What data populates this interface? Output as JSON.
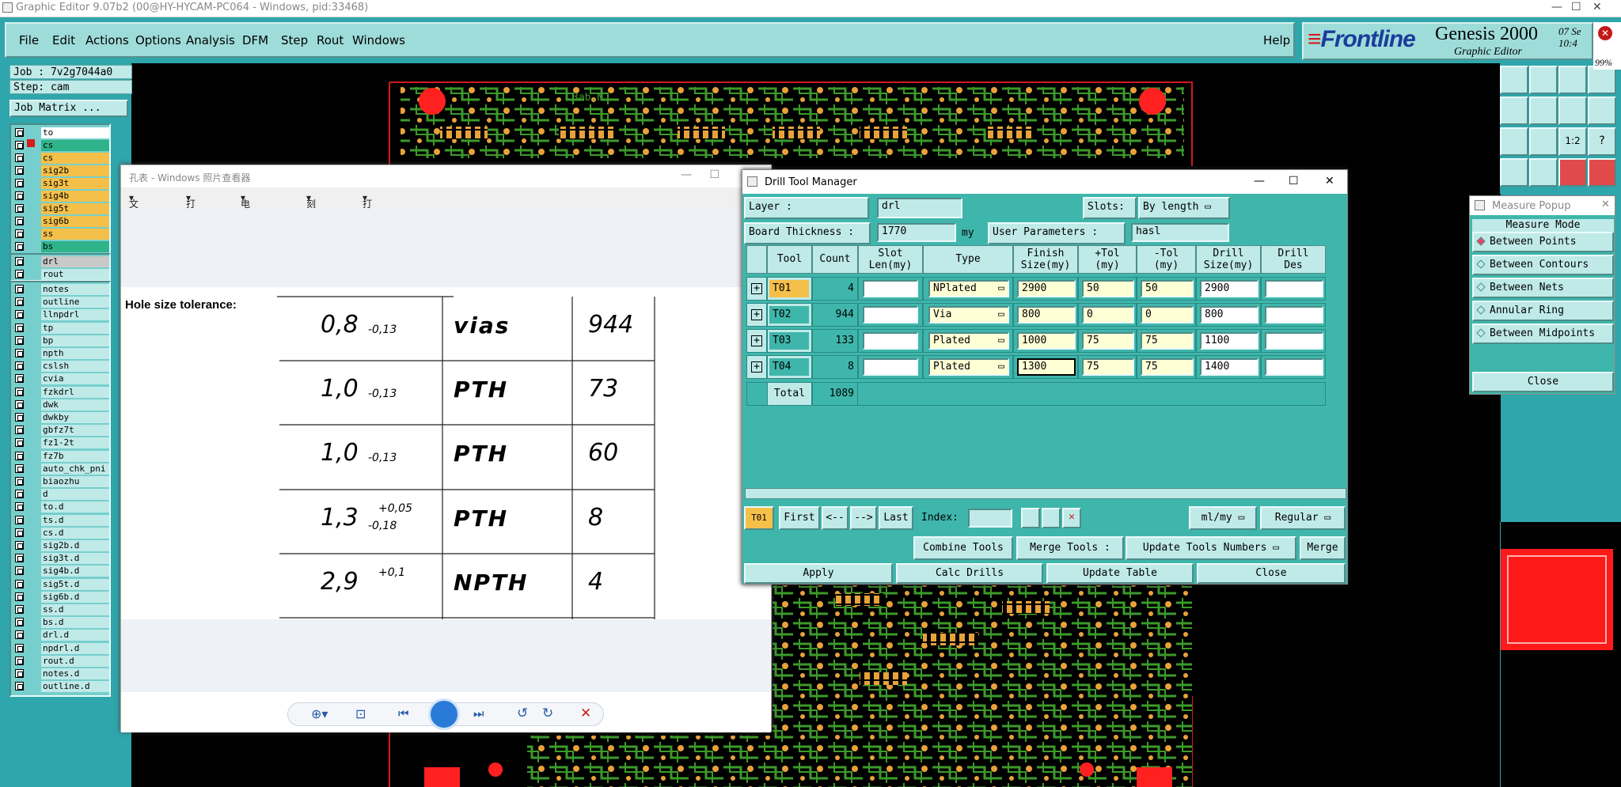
{
  "window": {
    "title": "Graphic Editor 9.07b2 (00@HY-HYCAM-PC064 - Windows, pid:33468)"
  },
  "menu": [
    "File",
    "Edit",
    "Actions",
    "Options",
    "Analysis",
    "DFM",
    "Step",
    "Rout",
    "Windows"
  ],
  "help": "Help",
  "brand": {
    "logo": "Frontline",
    "product": "Genesis 2000",
    "subtitle": "Graphic Editor",
    "date": "07 Se",
    "time": "10:4"
  },
  "job": {
    "job": "Job : 7v2g7044a0",
    "step": "Step: cam",
    "matrix_button": "Job Matrix ..."
  },
  "layers_top": [
    {
      "name": "to",
      "color": "#ffffff"
    },
    {
      "name": "cs",
      "color": "#2fb38a"
    },
    {
      "name": "cs",
      "color": "#f5c04a"
    },
    {
      "name": "sig2b",
      "color": "#f5c04a"
    },
    {
      "name": "sig3t",
      "color": "#f5c04a"
    },
    {
      "name": "sig4b",
      "color": "#f5c04a"
    },
    {
      "name": "sig5t",
      "color": "#f5c04a"
    },
    {
      "name": "sig6b",
      "color": "#f5c04a"
    },
    {
      "name": "ss",
      "color": "#f5c04a"
    },
    {
      "name": "bs",
      "color": "#2fb38a"
    }
  ],
  "layers_drill": [
    {
      "name": "drl",
      "color": "#c9c9c9"
    },
    {
      "name": "rout",
      "color": "#bfeae8"
    }
  ],
  "layers_misc": [
    "notes",
    "outline",
    "llnpdrl",
    "tp",
    "bp",
    "npth",
    "cslsh",
    "cvia",
    "fzkdrl",
    "dwk",
    "dwkby",
    "gbfz7t",
    "fz1-2t",
    "fz7b",
    "auto_chk_pni",
    "biaozhu",
    "d",
    "to.d",
    "ts.d",
    "cs.d",
    "sig2b.d",
    "sig3t.d",
    "sig4b.d",
    "sig5t.d",
    "sig6b.d",
    "ss.d",
    "bs.d",
    "drl.d",
    "npdrl.d",
    "rout.d",
    "notes.d",
    "outline.d"
  ],
  "pcb": {
    "text": "3ab.N"
  },
  "photo": {
    "title": "孔表 - Windows 照片查看器",
    "menu": [
      "文件(F)",
      "打印(P)",
      "电子邮件(E)",
      "刻录(U)",
      "打开(O)"
    ],
    "caption": "Hole size tolerance:",
    "rows": [
      {
        "size": "0,8",
        "tol_top": "",
        "tol_bot": "-0,13",
        "type": "vias",
        "count": "944"
      },
      {
        "size": "1,0",
        "tol_top": "",
        "tol_bot": "-0,13",
        "type": "PTH",
        "count": "73"
      },
      {
        "size": "1,0",
        "tol_top": "",
        "tol_bot": "-0,13",
        "type": "PTH",
        "count": "60"
      },
      {
        "size": "1,3",
        "tol_top": "+0,05",
        "tol_bot": "-0,18",
        "type": "PTH",
        "count": "8"
      },
      {
        "size": "2,9",
        "tol_top": "+0,1",
        "tol_bot": "",
        "type": "NPTH",
        "count": "4"
      }
    ]
  },
  "dtm": {
    "title": "Drill Tool Manager",
    "layer_label": "Layer      :",
    "layer_value": "drl",
    "slots_label": "Slots:",
    "slots_value": "By length",
    "thickness_label": "Board Thickness  :",
    "thickness_value": "1770",
    "thickness_unit": "my",
    "userparams_label": "User Parameters :",
    "userparams_value": "hasl",
    "headers": [
      "Tool",
      "Count",
      "Slot\nLen(my)",
      "Type",
      "Finish\nSize(my)",
      "+Tol\n(my)",
      "-Tol\n(my)",
      "Drill\nSize(my)",
      "Drill\nDes"
    ],
    "tools": [
      {
        "tool": "T01",
        "count": "4",
        "type": "NPlated",
        "finish": "2900",
        "ptol": "50",
        "mtol": "50",
        "drill": "2900"
      },
      {
        "tool": "T02",
        "count": "944",
        "type": "Via",
        "finish": "800",
        "ptol": "0",
        "mtol": "0",
        "drill": "800"
      },
      {
        "tool": "T03",
        "count": "133",
        "type": "Plated",
        "finish": "1000",
        "ptol": "75",
        "mtol": "75",
        "drill": "1100"
      },
      {
        "tool": "T04",
        "count": "8",
        "type": "Plated",
        "finish": "1300",
        "ptol": "75",
        "mtol": "75",
        "drill": "1400"
      }
    ],
    "total_label": "Total",
    "total_count": "1089",
    "nav": {
      "current": "T01",
      "first": "First",
      "prev": "<--",
      "next": "-->",
      "last": "Last",
      "index": "Index:",
      "units": "ml/my",
      "mode": "Regular"
    },
    "buttons_row1": {
      "combine": "Combine Tools",
      "merge_label": "Merge Tools :",
      "merge_value": "Update Tools Numbers",
      "merge": "Merge"
    },
    "buttons_row2": [
      "Apply",
      "Calc Drills",
      "Update Table",
      "Close"
    ]
  },
  "measure": {
    "title": "Measure Popup",
    "mode": "Measure Mode",
    "options": [
      "Between Points",
      "Between Contours",
      "Between Nets",
      "Annular Ring",
      "Between Midpoints"
    ],
    "close": "Close"
  },
  "zoom": "99%"
}
